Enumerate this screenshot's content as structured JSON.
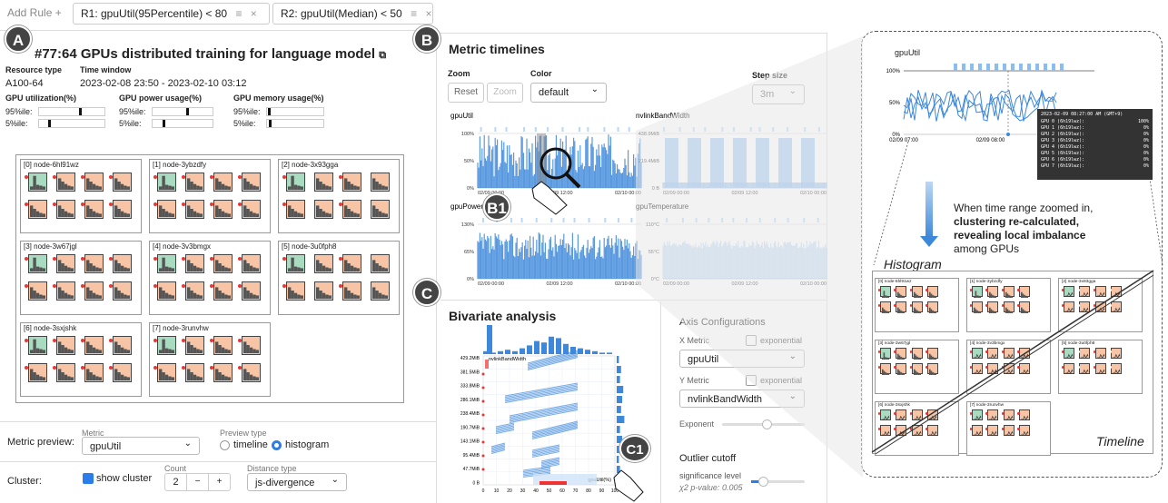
{
  "rules": {
    "add_label": "Add Rule +",
    "items": [
      {
        "label": "R1: gpuUtil(95Percentile) < 80"
      },
      {
        "label": "R2: gpuUtil(Median) < 50"
      }
    ]
  },
  "badges": {
    "a": "A",
    "b": "B",
    "b1": "B1",
    "c": "C",
    "c1": "C1"
  },
  "job": {
    "title": "#77:64 GPUs distributed training for language model",
    "resource_type_label": "Resource type",
    "resource_type": "A100-64",
    "time_window_label": "Time window",
    "time_window": "2023-02-08 23:50 - 2023-02-10 03:12",
    "metrics": [
      {
        "label": "GPU utilization(%)",
        "p95": 0.58,
        "p5": 0.14
      },
      {
        "label": "GPU power usage(%)",
        "p95": 0.55,
        "p5": 0.16
      },
      {
        "label": "GPU memory usage(%)",
        "p95": 0.02,
        "p5": 0.04
      }
    ],
    "p95_label": "95%ile:",
    "p5_label": "5%ile:"
  },
  "nodes": [
    {
      "name": "[0] node-6hl91wz"
    },
    {
      "name": "[1] node-3ybzdfy"
    },
    {
      "name": "[2] node-3x93gga"
    },
    {
      "name": "[3] node-3w67jgl"
    },
    {
      "name": "[4] node-3v3bmgx"
    },
    {
      "name": "[5] node-3u0fph8"
    },
    {
      "name": "[6] node-3sxjshk"
    },
    {
      "name": "[7] node-3runvhw"
    }
  ],
  "preview": {
    "label": "Metric preview:",
    "metric_caption": "Metric",
    "metric_value": "gpuUtil",
    "type_caption": "Preview type",
    "opt_timeline": "timeline",
    "opt_histogram": "histogram"
  },
  "cluster": {
    "label": "Cluster:",
    "show_label": "show cluster",
    "count_caption": "Count",
    "count_value": "2",
    "minus": "−",
    "plus": "+",
    "distance_caption": "Distance type",
    "distance_value": "js-divergence"
  },
  "timelines": {
    "title": "Metric timelines",
    "zoom_label": "Zoom",
    "reset": "Reset",
    "zoom": "Zoom",
    "color_label": "Color",
    "color_value": "default",
    "step_label": "Step size",
    "step_value": "3m",
    "charts": [
      {
        "name": "gpuUtil",
        "yticks": [
          "100%",
          "50%",
          "0%"
        ],
        "xticks": [
          "02/09 00:00",
          "02/09 12:00",
          "02/10 00:00"
        ]
      },
      {
        "name": "nvlinkBandWidth",
        "yticks": [
          "438.9MiB",
          "219.4MiB",
          "0 B"
        ],
        "xticks": [
          "02/09 00:00",
          "02/09 12:00",
          "02/10 00:00"
        ]
      },
      {
        "name": "gpuPower",
        "yticks": [
          "130%",
          "65%",
          "0%"
        ],
        "xticks": [
          "02/09 00:00",
          "02/09 12:00",
          "02/10 00:00"
        ]
      },
      {
        "name": "gpuTemperature",
        "yticks": [
          "110°C",
          "55°C",
          "0°C"
        ],
        "xticks": [
          "02/09 00:00",
          "02/09 12:00",
          "02/10 00:00"
        ]
      }
    ]
  },
  "bivariate": {
    "title": "Bivariate analysis",
    "inner_label": "nvlinkBandWidth",
    "x_label": "gpuUtil(%)",
    "yticks": [
      "429.2MiB",
      "381.5MiB",
      "333.8MiB",
      "286.1MiB",
      "238.4MiB",
      "190.7MiB",
      "143.1MiB",
      "95.4MiB",
      "47.7MiB",
      "0 B"
    ],
    "xticks": [
      "0",
      "10",
      "20",
      "30",
      "40",
      "50",
      "60",
      "70",
      "80",
      "90",
      "100"
    ]
  },
  "axis_config": {
    "title": "Axis Configurations",
    "x_caption": "X Metric",
    "x_value": "gpuUtil",
    "y_caption": "Y Metric",
    "y_value": "nvlinkBandWidth",
    "exp_label": "exponential",
    "exponent_label": "Exponent",
    "outlier_title": "Outlier cutoff",
    "sig_label": "significance level",
    "pvalue_label": "χ2 p-value: 0.005"
  },
  "zoomed": {
    "chart_title": "gpuUtil",
    "yticks": [
      "100%",
      "50%",
      "0%"
    ],
    "xticks": [
      "02/09 07:00",
      "02/09 08:00",
      "02/09 09:00"
    ],
    "tooltip_title": "2023-02-09 08:27:00 AM (GMT+9)",
    "tooltip_rows": [
      {
        "gpu": "GPU 0 (6h19lwz):",
        "v": "100%"
      },
      {
        "gpu": "GPU 1 (6h19lwz):",
        "v": "0%"
      },
      {
        "gpu": "GPU 2 (6h19lwz):",
        "v": "0%"
      },
      {
        "gpu": "GPU 3 (6h19lwz):",
        "v": "0%"
      },
      {
        "gpu": "GPU 4 (6h19lwz):",
        "v": "0%"
      },
      {
        "gpu": "GPU 5 (6h19lwz):",
        "v": "0%"
      },
      {
        "gpu": "GPU 6 (6h19lwz):",
        "v": "0%"
      },
      {
        "gpu": "GPU 7 (6h19lwz):",
        "v": "0%"
      }
    ],
    "note_line1": "When time range zoomed in,",
    "note_line2": "clustering re-calculated,",
    "note_line3": "revealing local imbalance",
    "note_line4": "among GPUs",
    "histogram_label": "Histogram",
    "timeline_label": "Timeline"
  },
  "colors": {
    "accent": "#2b7de9",
    "green": "#a9dbc0",
    "orange": "#f7c4a5",
    "red": "#e33333"
  }
}
